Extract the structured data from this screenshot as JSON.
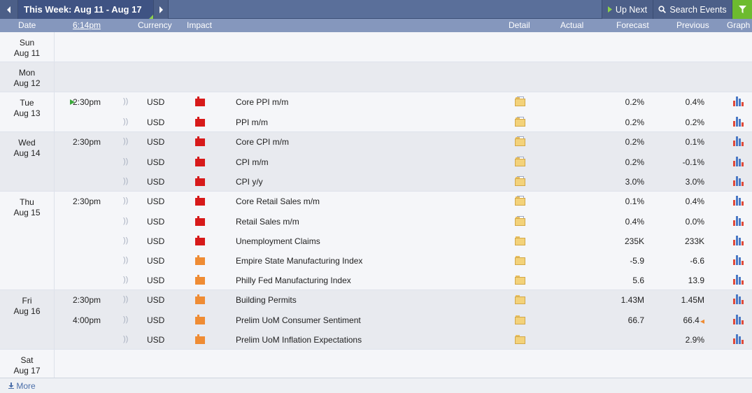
{
  "toolbar": {
    "prev_icon": "chevron-left-icon",
    "week_label": "This Week: Aug 11 - Aug 17",
    "next_icon": "chevron-right-icon",
    "up_next_label": "Up Next",
    "search_label": "Search Events",
    "filter_icon": "filter-icon"
  },
  "columns": {
    "date": "Date",
    "time": "6:14pm",
    "currency": "Currency",
    "impact": "Impact",
    "detail": "Detail",
    "actual": "Actual",
    "forecast": "Forecast",
    "previous": "Previous",
    "graph": "Graph"
  },
  "colors": {
    "high_impact": "#d71a1a",
    "medium_impact": "#ef8c34",
    "header_bar": "#5a6f9a",
    "filter_active": "#6dbb2f"
  },
  "days": [
    {
      "weekday": "Sun",
      "date": "Aug 11",
      "events": []
    },
    {
      "weekday": "Mon",
      "date": "Aug 12",
      "events": []
    },
    {
      "weekday": "Tue",
      "date": "Aug 13",
      "events": [
        {
          "time": "2:30pm",
          "up_next": true,
          "currency": "USD",
          "impact": "high",
          "name": "Core PPI m/m",
          "actual": "",
          "forecast": "0.2%",
          "previous": "0.4%",
          "previous_revised": false,
          "detail_icon": "folder-doc-icon"
        },
        {
          "time": "",
          "up_next": false,
          "currency": "USD",
          "impact": "high",
          "name": "PPI m/m",
          "actual": "",
          "forecast": "0.2%",
          "previous": "0.2%",
          "previous_revised": false,
          "detail_icon": "folder-doc-icon"
        }
      ]
    },
    {
      "weekday": "Wed",
      "date": "Aug 14",
      "events": [
        {
          "time": "2:30pm",
          "up_next": false,
          "currency": "USD",
          "impact": "high",
          "name": "Core CPI m/m",
          "actual": "",
          "forecast": "0.2%",
          "previous": "0.1%",
          "previous_revised": false,
          "detail_icon": "folder-doc-icon"
        },
        {
          "time": "",
          "up_next": false,
          "currency": "USD",
          "impact": "high",
          "name": "CPI m/m",
          "actual": "",
          "forecast": "0.2%",
          "previous": "-0.1%",
          "previous_revised": false,
          "detail_icon": "folder-doc-icon"
        },
        {
          "time": "",
          "up_next": false,
          "currency": "USD",
          "impact": "high",
          "name": "CPI y/y",
          "actual": "",
          "forecast": "3.0%",
          "previous": "3.0%",
          "previous_revised": false,
          "detail_icon": "folder-doc-icon"
        }
      ]
    },
    {
      "weekday": "Thu",
      "date": "Aug 15",
      "events": [
        {
          "time": "2:30pm",
          "up_next": false,
          "currency": "USD",
          "impact": "high",
          "name": "Core Retail Sales m/m",
          "actual": "",
          "forecast": "0.1%",
          "previous": "0.4%",
          "previous_revised": false,
          "detail_icon": "folder-doc-icon"
        },
        {
          "time": "",
          "up_next": false,
          "currency": "USD",
          "impact": "high",
          "name": "Retail Sales m/m",
          "actual": "",
          "forecast": "0.4%",
          "previous": "0.0%",
          "previous_revised": false,
          "detail_icon": "folder-doc-icon"
        },
        {
          "time": "",
          "up_next": false,
          "currency": "USD",
          "impact": "high",
          "name": "Unemployment Claims",
          "actual": "",
          "forecast": "235K",
          "previous": "233K",
          "previous_revised": false,
          "detail_icon": "folder-icon"
        },
        {
          "time": "",
          "up_next": false,
          "currency": "USD",
          "impact": "medium",
          "name": "Empire State Manufacturing Index",
          "actual": "",
          "forecast": "-5.9",
          "previous": "-6.6",
          "previous_revised": false,
          "detail_icon": "folder-icon"
        },
        {
          "time": "",
          "up_next": false,
          "currency": "USD",
          "impact": "medium",
          "name": "Philly Fed Manufacturing Index",
          "actual": "",
          "forecast": "5.6",
          "previous": "13.9",
          "previous_revised": false,
          "detail_icon": "folder-icon"
        }
      ]
    },
    {
      "weekday": "Fri",
      "date": "Aug 16",
      "events": [
        {
          "time": "2:30pm",
          "up_next": false,
          "currency": "USD",
          "impact": "medium",
          "name": "Building Permits",
          "actual": "",
          "forecast": "1.43M",
          "previous": "1.45M",
          "previous_revised": false,
          "detail_icon": "folder-icon"
        },
        {
          "time": "4:00pm",
          "up_next": false,
          "currency": "USD",
          "impact": "medium",
          "name": "Prelim UoM Consumer Sentiment",
          "actual": "",
          "forecast": "66.7",
          "previous": "66.4",
          "previous_revised": true,
          "detail_icon": "folder-icon"
        },
        {
          "time": "",
          "up_next": false,
          "currency": "USD",
          "impact": "medium",
          "name": "Prelim UoM Inflation Expectations",
          "actual": "",
          "forecast": "",
          "previous": "2.9%",
          "previous_revised": false,
          "detail_icon": "folder-icon"
        }
      ]
    },
    {
      "weekday": "Sat",
      "date": "Aug 17",
      "events": []
    }
  ],
  "footer": {
    "more_label": "More",
    "more_icon": "download-arrow-icon"
  }
}
